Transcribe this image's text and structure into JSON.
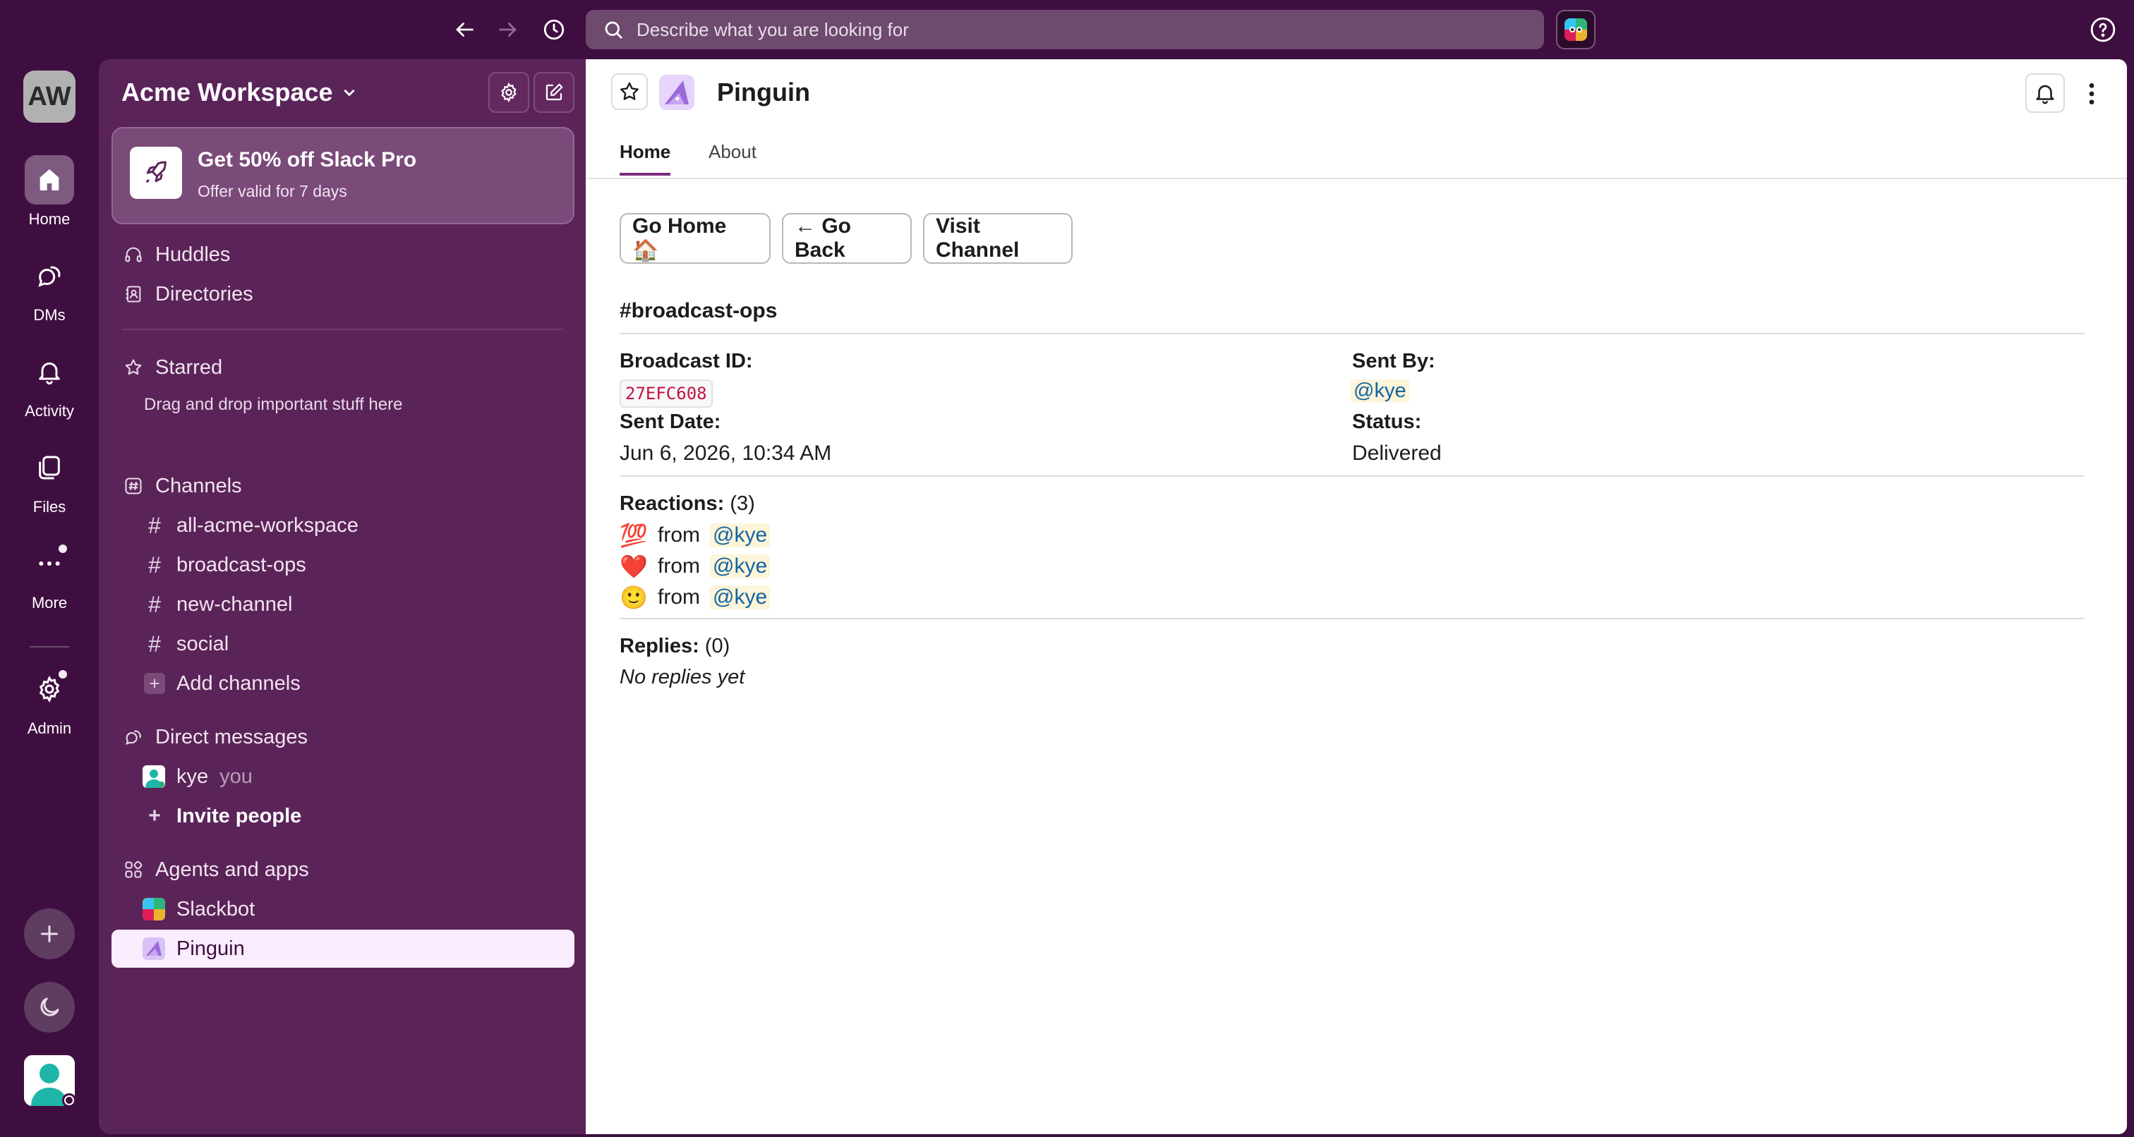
{
  "topbar": {
    "search_placeholder": "Describe what you are looking for"
  },
  "rail": {
    "workspace_initials": "AW",
    "items": [
      {
        "label": "Home"
      },
      {
        "label": "DMs"
      },
      {
        "label": "Activity"
      },
      {
        "label": "Files"
      },
      {
        "label": "More"
      },
      {
        "label": "Admin"
      }
    ]
  },
  "sidebar": {
    "workspace_name": "Acme Workspace",
    "promo": {
      "title": "Get 50% off Slack Pro",
      "subtitle": "Offer valid for 7 days"
    },
    "nav": [
      {
        "label": "Huddles"
      },
      {
        "label": "Directories"
      }
    ],
    "starred": {
      "label": "Starred",
      "hint": "Drag and drop important stuff here"
    },
    "channels": {
      "label": "Channels",
      "items": [
        "all-acme-workspace",
        "broadcast-ops",
        "new-channel",
        "social"
      ],
      "add_label": "Add channels"
    },
    "dms": {
      "label": "Direct messages",
      "user": "kye",
      "user_suffix": "you",
      "invite_label": "Invite people"
    },
    "apps": {
      "label": "Agents and apps",
      "items": [
        "Slackbot",
        "Pinguin"
      ]
    }
  },
  "main": {
    "title": "Pinguin",
    "tabs": [
      "Home",
      "About"
    ],
    "buttons": {
      "home": "Go Home 🏠",
      "back": "← Go Back",
      "visit": "Visit Channel"
    },
    "channel": "#broadcast-ops",
    "fields": {
      "broadcast_id_label": "Broadcast ID:",
      "broadcast_id": "27EFC608",
      "sent_by_label": "Sent By:",
      "sent_by": "@kye",
      "sent_date_label": "Sent Date:",
      "sent_date": "Jun 6, 2026, 10:34 AM",
      "status_label": "Status:",
      "status": "Delivered"
    },
    "reactions": {
      "label": "Reactions:",
      "count": "(3)",
      "items": [
        {
          "emoji": "💯",
          "from": "from",
          "user": "@kye"
        },
        {
          "emoji": "❤️",
          "from": "from",
          "user": "@kye"
        },
        {
          "emoji": "🙂",
          "from": "from",
          "user": "@kye"
        }
      ]
    },
    "replies": {
      "label": "Replies:",
      "count": "(0)",
      "empty": "No replies yet"
    }
  },
  "colors": {
    "aubergine": "#3f0e40",
    "sidebar": "#5b2459",
    "selected_row": "#f9edff",
    "link": "#1264a3",
    "code_red": "#c01343"
  }
}
